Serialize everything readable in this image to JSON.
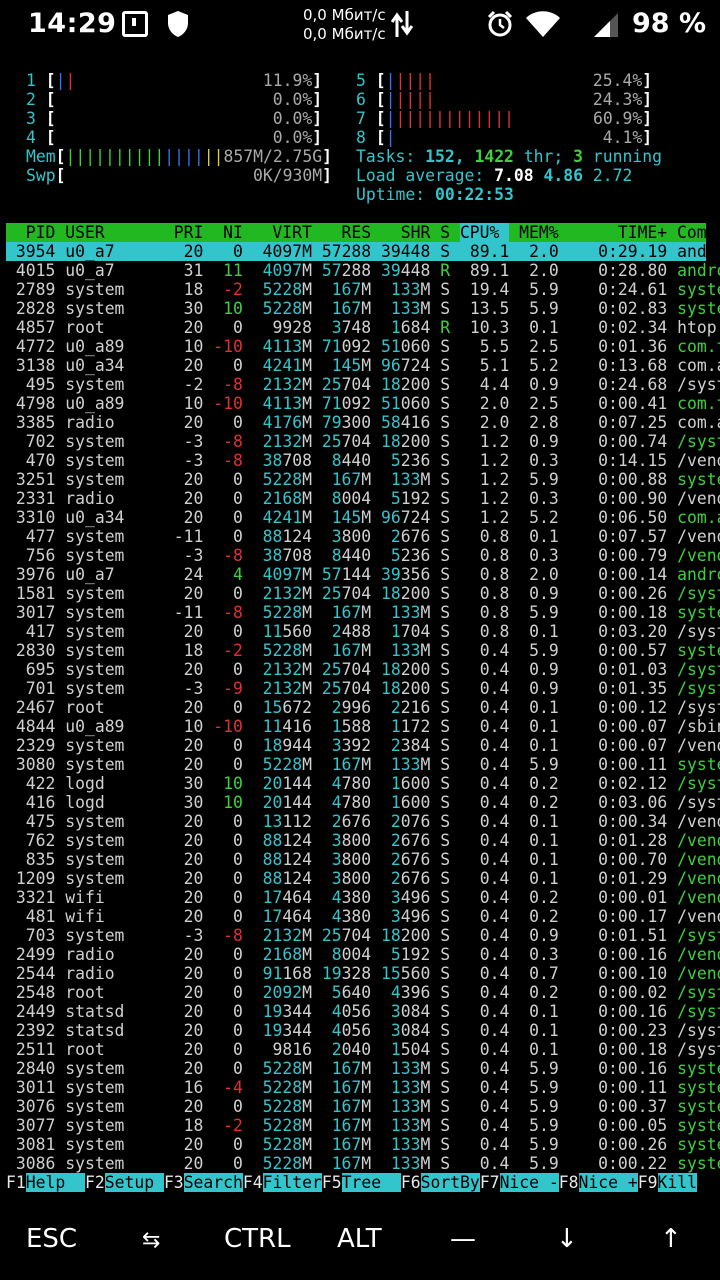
{
  "statusbar": {
    "time": "14:29",
    "net_up": "0,0 Мбит/с",
    "net_down": "0,0 Мбит/с",
    "battery": "98 %",
    "icons": [
      "screenshot-icon",
      "shield-icon",
      "data-arrows-icon",
      "alarm-icon",
      "wifi-icon",
      "cell-signal-icon"
    ]
  },
  "meters": {
    "cpus": [
      {
        "id": "1",
        "pct": "11.9%",
        "value": 11.9
      },
      {
        "id": "2",
        "pct": "0.0%",
        "value": 0.0
      },
      {
        "id": "3",
        "pct": "0.0%",
        "value": 0.0
      },
      {
        "id": "4",
        "pct": "0.0%",
        "value": 0.0
      },
      {
        "id": "5",
        "pct": "25.4%",
        "value": 25.4
      },
      {
        "id": "6",
        "pct": "24.3%",
        "value": 24.3
      },
      {
        "id": "7",
        "pct": "60.9%",
        "value": 60.9
      },
      {
        "id": "8",
        "pct": "4.1%",
        "value": 4.1
      }
    ],
    "mem_label": "Mem",
    "mem_value": "857M/2.75G",
    "swp_label": "Swp",
    "swp_value": "0K/930M"
  },
  "summary": {
    "tasks_label": "Tasks:",
    "tasks": "152,",
    "thr": "1422",
    "thr_label": "thr;",
    "running": "3",
    "running_label": "running",
    "load_label": "Load average:",
    "load1": "7.08",
    "load5": "4.86",
    "load15": "2.72",
    "uptime_label": "Uptime:",
    "uptime": "00:22:53"
  },
  "columns": [
    "PID",
    "USER",
    "PRI",
    "NI",
    "VIRT",
    "RES",
    "SHR",
    "S",
    "CPU%",
    "MEM%",
    "TIME+",
    "Command"
  ],
  "processes": [
    [
      "3954",
      "u0_a7",
      "20",
      "0",
      "4097M",
      "57288",
      "39448",
      "S",
      "89.1",
      "2.0",
      "0:29.19",
      "android"
    ],
    [
      "4015",
      "u0_a7",
      "31",
      "11",
      "4097M",
      "57288",
      "39448",
      "R",
      "89.1",
      "2.0",
      "0:28.80",
      "android"
    ],
    [
      "2789",
      "system",
      "18",
      "-2",
      "5228M",
      "167M",
      "133M",
      "S",
      "19.4",
      "5.9",
      "0:24.61",
      "system_"
    ],
    [
      "2828",
      "system",
      "30",
      "10",
      "5228M",
      "167M",
      "133M",
      "S",
      "13.5",
      "5.9",
      "0:02.83",
      "system_"
    ],
    [
      "4857",
      "root",
      "20",
      "0",
      "9928",
      "3748",
      "1684",
      "R",
      "10.3",
      "0.1",
      "0:02.34",
      "htop"
    ],
    [
      "4772",
      "u0_a89",
      "10",
      "-10",
      "4113M",
      "71092",
      "51060",
      "S",
      "5.5",
      "2.5",
      "0:01.36",
      "com.ter"
    ],
    [
      "3138",
      "u0_a34",
      "20",
      "0",
      "4241M",
      "145M",
      "96724",
      "S",
      "5.1",
      "5.2",
      "0:13.68",
      "com.and"
    ],
    [
      "495",
      "system",
      "-2",
      "-8",
      "2132M",
      "25704",
      "18200",
      "S",
      "4.4",
      "0.9",
      "0:24.68",
      "/system"
    ],
    [
      "4798",
      "u0_a89",
      "10",
      "-10",
      "4113M",
      "71092",
      "51060",
      "S",
      "2.0",
      "2.5",
      "0:00.41",
      "com.ter"
    ],
    [
      "3385",
      "radio",
      "20",
      "0",
      "4176M",
      "79300",
      "58416",
      "S",
      "2.0",
      "2.8",
      "0:07.25",
      "com.and"
    ],
    [
      "702",
      "system",
      "-3",
      "-8",
      "2132M",
      "25704",
      "18200",
      "S",
      "1.2",
      "0.9",
      "0:00.74",
      "/system"
    ],
    [
      "470",
      "system",
      "-3",
      "-8",
      "38708",
      "8440",
      "5236",
      "S",
      "1.2",
      "0.3",
      "0:14.15",
      "/vendor"
    ],
    [
      "3251",
      "system",
      "20",
      "0",
      "5228M",
      "167M",
      "133M",
      "S",
      "1.2",
      "5.9",
      "0:00.88",
      "system_"
    ],
    [
      "2331",
      "radio",
      "20",
      "0",
      "2168M",
      "8004",
      "5192",
      "S",
      "1.2",
      "0.3",
      "0:00.90",
      "/vendor"
    ],
    [
      "3310",
      "u0_a34",
      "20",
      "0",
      "4241M",
      "145M",
      "96724",
      "S",
      "1.2",
      "5.2",
      "0:06.50",
      "com.and"
    ],
    [
      "477",
      "system",
      "-11",
      "0",
      "88124",
      "3800",
      "2676",
      "S",
      "0.8",
      "0.1",
      "0:07.57",
      "/vendor"
    ],
    [
      "756",
      "system",
      "-3",
      "-8",
      "38708",
      "8440",
      "5236",
      "S",
      "0.8",
      "0.3",
      "0:00.79",
      "/vendor"
    ],
    [
      "3976",
      "u0_a7",
      "24",
      "4",
      "4097M",
      "57144",
      "39356",
      "S",
      "0.8",
      "2.0",
      "0:00.14",
      "android"
    ],
    [
      "1581",
      "system",
      "20",
      "0",
      "2132M",
      "25704",
      "18200",
      "S",
      "0.8",
      "0.9",
      "0:00.26",
      "/system"
    ],
    [
      "3017",
      "system",
      "-11",
      "-8",
      "5228M",
      "167M",
      "133M",
      "S",
      "0.8",
      "5.9",
      "0:00.18",
      "system_"
    ],
    [
      "417",
      "system",
      "20",
      "0",
      "11560",
      "2488",
      "1704",
      "S",
      "0.8",
      "0.1",
      "0:03.20",
      "/system"
    ],
    [
      "2830",
      "system",
      "18",
      "-2",
      "5228M",
      "167M",
      "133M",
      "S",
      "0.4",
      "5.9",
      "0:00.57",
      "system_"
    ],
    [
      "695",
      "system",
      "20",
      "0",
      "2132M",
      "25704",
      "18200",
      "S",
      "0.4",
      "0.9",
      "0:01.03",
      "/system"
    ],
    [
      "701",
      "system",
      "-3",
      "-9",
      "2132M",
      "25704",
      "18200",
      "S",
      "0.4",
      "0.9",
      "0:01.35",
      "/system"
    ],
    [
      "2467",
      "root",
      "20",
      "0",
      "15672",
      "2996",
      "2216",
      "S",
      "0.4",
      "0.1",
      "0:00.12",
      "/system"
    ],
    [
      "4844",
      "u0_a89",
      "10",
      "-10",
      "11416",
      "1588",
      "1172",
      "S",
      "0.4",
      "0.1",
      "0:00.07",
      "/sbin/s"
    ],
    [
      "2329",
      "system",
      "20",
      "0",
      "18944",
      "3392",
      "2384",
      "S",
      "0.4",
      "0.1",
      "0:00.07",
      "/vendor"
    ],
    [
      "3080",
      "system",
      "20",
      "0",
      "5228M",
      "167M",
      "133M",
      "S",
      "0.4",
      "5.9",
      "0:00.11",
      "system_"
    ],
    [
      "422",
      "logd",
      "30",
      "10",
      "20144",
      "4780",
      "1600",
      "S",
      "0.4",
      "0.2",
      "0:02.12",
      "/system"
    ],
    [
      "416",
      "logd",
      "30",
      "10",
      "20144",
      "4780",
      "1600",
      "S",
      "0.4",
      "0.2",
      "0:03.06",
      "/system"
    ],
    [
      "475",
      "system",
      "20",
      "0",
      "13112",
      "2676",
      "2076",
      "S",
      "0.4",
      "0.1",
      "0:00.34",
      "/vendor"
    ],
    [
      "762",
      "system",
      "20",
      "0",
      "88124",
      "3800",
      "2676",
      "S",
      "0.4",
      "0.1",
      "0:01.28",
      "/vendor"
    ],
    [
      "835",
      "system",
      "20",
      "0",
      "88124",
      "3800",
      "2676",
      "S",
      "0.4",
      "0.1",
      "0:00.70",
      "/vendor"
    ],
    [
      "1209",
      "system",
      "20",
      "0",
      "88124",
      "3800",
      "2676",
      "S",
      "0.4",
      "0.1",
      "0:01.29",
      "/vendor"
    ],
    [
      "3321",
      "wifi",
      "20",
      "0",
      "17464",
      "4380",
      "3496",
      "S",
      "0.4",
      "0.2",
      "0:00.01",
      "/vendor"
    ],
    [
      "481",
      "wifi",
      "20",
      "0",
      "17464",
      "4380",
      "3496",
      "S",
      "0.4",
      "0.2",
      "0:00.17",
      "/vendor"
    ],
    [
      "703",
      "system",
      "-3",
      "-8",
      "2132M",
      "25704",
      "18200",
      "S",
      "0.4",
      "0.9",
      "0:01.51",
      "/system"
    ],
    [
      "2499",
      "radio",
      "20",
      "0",
      "2168M",
      "8004",
      "5192",
      "S",
      "0.4",
      "0.3",
      "0:00.16",
      "/vendor"
    ],
    [
      "2544",
      "radio",
      "20",
      "0",
      "91168",
      "19328",
      "15560",
      "S",
      "0.4",
      "0.7",
      "0:00.10",
      "/vendor"
    ],
    [
      "2548",
      "root",
      "20",
      "0",
      "2092M",
      "5640",
      "4396",
      "S",
      "0.4",
      "0.2",
      "0:00.02",
      "/system"
    ],
    [
      "2449",
      "statsd",
      "20",
      "0",
      "19344",
      "4056",
      "3084",
      "S",
      "0.4",
      "0.1",
      "0:00.16",
      "/system"
    ],
    [
      "2392",
      "statsd",
      "20",
      "0",
      "19344",
      "4056",
      "3084",
      "S",
      "0.4",
      "0.1",
      "0:00.23",
      "/system"
    ],
    [
      "2511",
      "root",
      "20",
      "0",
      "9816",
      "2040",
      "1504",
      "S",
      "0.4",
      "0.1",
      "0:00.18",
      "/system"
    ],
    [
      "2840",
      "system",
      "20",
      "0",
      "5228M",
      "167M",
      "133M",
      "S",
      "0.4",
      "5.9",
      "0:00.16",
      "system_"
    ],
    [
      "3011",
      "system",
      "16",
      "-4",
      "5228M",
      "167M",
      "133M",
      "S",
      "0.4",
      "5.9",
      "0:00.11",
      "system_"
    ],
    [
      "3076",
      "system",
      "20",
      "0",
      "5228M",
      "167M",
      "133M",
      "S",
      "0.4",
      "5.9",
      "0:00.37",
      "system_"
    ],
    [
      "3077",
      "system",
      "18",
      "-2",
      "5228M",
      "167M",
      "133M",
      "S",
      "0.4",
      "5.9",
      "0:00.05",
      "system_"
    ],
    [
      "3081",
      "system",
      "20",
      "0",
      "5228M",
      "167M",
      "133M",
      "S",
      "0.4",
      "5.9",
      "0:00.26",
      "system_"
    ],
    [
      "3086",
      "system",
      "20",
      "0",
      "5228M",
      "167M",
      "133M",
      "S",
      "0.4",
      "5.9",
      "0:00.22",
      "system_"
    ]
  ],
  "selected_row": 0,
  "fkeys": [
    {
      "key": "F1",
      "label": "Help  "
    },
    {
      "key": "F2",
      "label": "Setup "
    },
    {
      "key": "F3",
      "label": "Search"
    },
    {
      "key": "F4",
      "label": "Filter"
    },
    {
      "key": "F5",
      "label": "Tree  "
    },
    {
      "key": "F6",
      "label": "SortBy"
    },
    {
      "key": "F7",
      "label": "Nice -"
    },
    {
      "key": "F8",
      "label": "Nice +"
    },
    {
      "key": "F9",
      "label": "Kill"
    }
  ],
  "extra_keys": {
    "esc": "ESC",
    "tab": "⇆",
    "ctrl": "CTRL",
    "alt": "ALT",
    "dash": "—",
    "down": "↓",
    "up": "↑"
  },
  "colors": {
    "cyan": "#33c5cc",
    "green": "#3cd23c",
    "red": "#e03030",
    "blue": "#3b6ff0",
    "yellow": "#d6d23a",
    "header_bg": "#22b822"
  }
}
